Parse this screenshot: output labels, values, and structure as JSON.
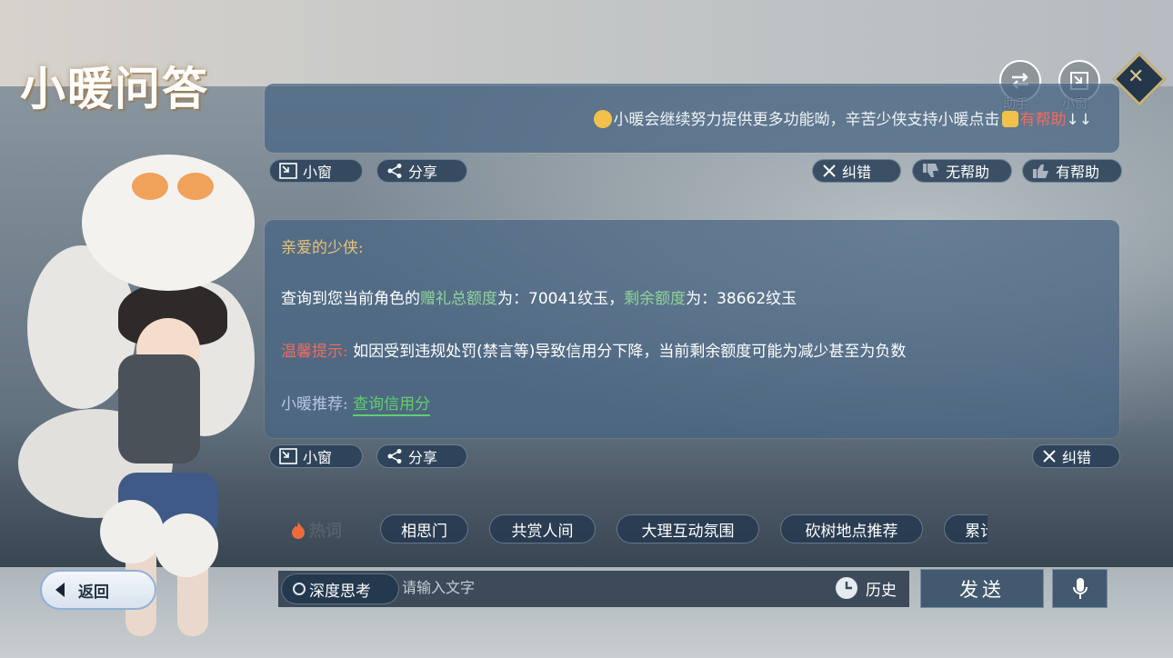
{
  "app": {
    "title": "小暖问答"
  },
  "top_controls": {
    "assistant_label": "助手",
    "small_window_label": "小窗"
  },
  "message1": {
    "text_prefix": "小暖会继续努力提供更多功能呦，辛苦少侠支持小暖点击",
    "text_highlight": "有帮助",
    "text_suffix": "↓↓"
  },
  "message1_actions": {
    "small_window": "小窗",
    "share": "分享",
    "correct": "纠错",
    "not_helpful": "无帮助",
    "helpful": "有帮助"
  },
  "message2": {
    "greeting": "亲爱的少侠:",
    "line1": {
      "part1": "查询到您当前角色的",
      "key1": "赠礼总额度",
      "part2": "为：70041纹玉，",
      "key2": "剩余额度",
      "part3": "为：38662纹玉"
    },
    "line2": {
      "label": "温馨提示:",
      "text": " 如因受到违规处罚(禁言等)导致信用分下降，当前剩余额度可能为减少甚至为负数"
    },
    "line3": {
      "label": "小暖推荐:",
      "link": "查询信用分"
    }
  },
  "message2_actions": {
    "small_window": "小窗",
    "share": "分享",
    "correct": "纠错"
  },
  "hot_words": {
    "label": "热词",
    "items": [
      "相思门",
      "共赏人间",
      "大理互动氛围",
      "砍树地点推荐",
      "累计"
    ]
  },
  "input_bar": {
    "back_label": "返回",
    "deep_think_label": "深度思考",
    "placeholder": "请输入文字",
    "history_label": "历史",
    "send_label": "发送"
  },
  "colors": {
    "panel_bg": "#46648299",
    "highlight_green": "#8fd49a",
    "link_green": "#5ed06e",
    "warn_red": "#f16b5f",
    "greeting_gold": "#e7c27a"
  }
}
